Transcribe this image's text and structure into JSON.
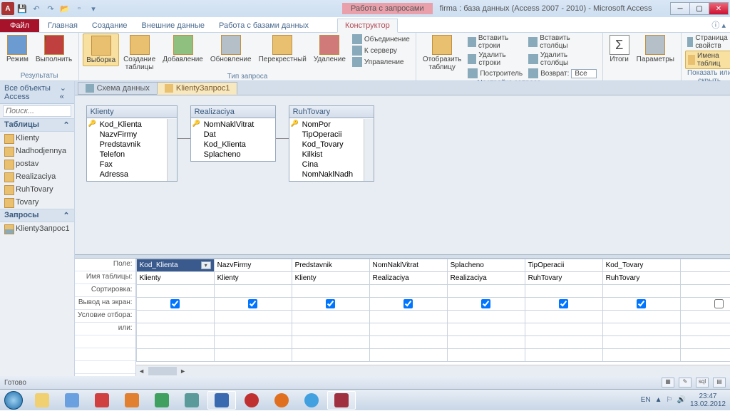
{
  "qat": {
    "app_letter": "A"
  },
  "context_tab": "Работа с запросами",
  "title": "firma : база данных (Access 2007 - 2010) - Microsoft Access",
  "tabs": {
    "file": "Файл",
    "items": [
      "Главная",
      "Создание",
      "Внешние данные",
      "Работа с базами данных"
    ],
    "context": "Конструктор"
  },
  "ribbon": {
    "g1": {
      "label": "Результаты",
      "btn1": "Режим",
      "btn2": "Выполнить"
    },
    "g2": {
      "label": "Тип запроса",
      "b1": "Выборка",
      "b2": "Создание\nтаблицы",
      "b3": "Добавление",
      "b4": "Обновление",
      "b5": "Перекрестный",
      "b6": "Удаление",
      "s1": "Объединение",
      "s2": "К серверу",
      "s3": "Управление"
    },
    "g3": {
      "label": "Настройка запроса",
      "big": "Отобразить\nтаблицу",
      "c1a": "Вставить строки",
      "c1b": "Удалить строки",
      "c1c": "Построитель",
      "c2a": "Вставить столбцы",
      "c2b": "Удалить столбцы",
      "c2c": "Возврат:",
      "c2v": "Все"
    },
    "g4": {
      "label": "",
      "b1": "Итоги",
      "b2": "Параметры"
    },
    "g5": {
      "label": "Показать или скрыть",
      "s1": "Страница свойств",
      "s2": "Имена таблиц"
    }
  },
  "nav": {
    "title": "Все объекты Access",
    "search": "Поиск...",
    "g1": "Таблицы",
    "tables": [
      "Klienty",
      "Nadhodjennya",
      "postav",
      "Realizaciya",
      "RuhTovary",
      "Tovary"
    ],
    "g2": "Запросы",
    "queries": [
      "KlientyЗапрос1"
    ]
  },
  "doctabs": {
    "t1": "Схема данных",
    "t2": "KlientyЗапрос1"
  },
  "boxes": {
    "b1": {
      "title": "Klienty",
      "fields": [
        "Kod_Klienta",
        "NazvFirmy",
        "Predstavnik",
        "Telefon",
        "Fax",
        "Adressa"
      ]
    },
    "b2": {
      "title": "Realizaciya",
      "fields": [
        "NomNaklVitrat",
        "Dat",
        "Kod_Klienta",
        "Splacheno"
      ]
    },
    "b3": {
      "title": "RuhTovary",
      "fields": [
        "NomPor",
        "TipOperacii",
        "Kod_Tovary",
        "Kilkist",
        "Cina",
        "NomNaklNadh"
      ]
    }
  },
  "grid": {
    "rowlabels": [
      "Поле:",
      "Имя таблицы:",
      "Сортировка:",
      "Вывод на экран:",
      "Условие отбора:",
      "или:"
    ],
    "cols": [
      {
        "f": "Kod_Klienta",
        "t": "Klienty"
      },
      {
        "f": "NazvFirmy",
        "t": "Klienty"
      },
      {
        "f": "Predstavnik",
        "t": "Klienty"
      },
      {
        "f": "NomNaklVitrat",
        "t": "Realizaciya"
      },
      {
        "f": "Splacheno",
        "t": "Realizaciya"
      },
      {
        "f": "TipOperacii",
        "t": "RuhTovary"
      },
      {
        "f": "Kod_Tovary",
        "t": "RuhTovary"
      }
    ]
  },
  "status": "Готово",
  "tray": {
    "lang": "EN",
    "time": "23:47",
    "date": "13.02.2012"
  }
}
